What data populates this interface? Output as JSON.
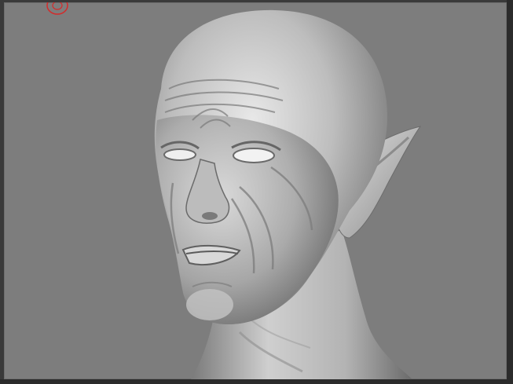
{
  "viewport": {
    "background_color": "#7d7d7d",
    "model": "sculpted-goblin-head",
    "material": "matcap-gray"
  },
  "cursor": {
    "icon": "brush-cursor-icon",
    "color": "#d42a2a"
  }
}
